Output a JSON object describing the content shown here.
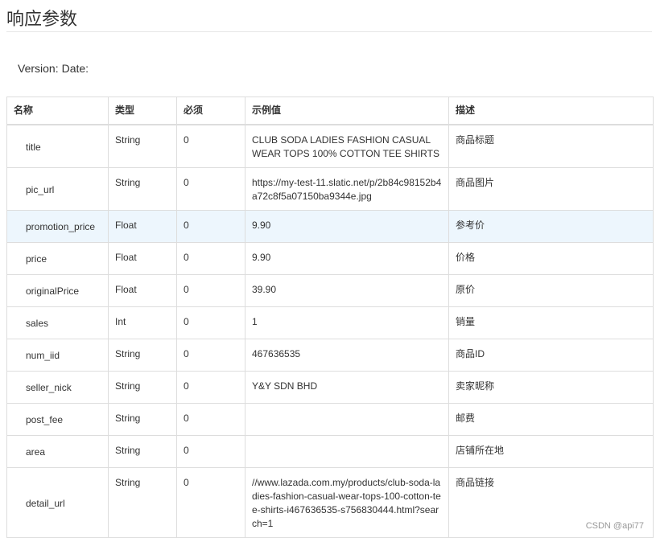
{
  "page_title": "响应参数",
  "meta": {
    "version_label": "Version:",
    "date_label": "Date:"
  },
  "table": {
    "headers": [
      "名称",
      "类型",
      "必须",
      "示例值",
      "描述"
    ],
    "rows": [
      {
        "name": "title",
        "type": "String",
        "required": "0",
        "example": "CLUB SODA LADIES FASHION CASUAL WEAR TOPS 100% COTTON TEE SHIRTS",
        "desc": "商品标题"
      },
      {
        "name": "pic_url",
        "type": "String",
        "required": "0",
        "example": "https://my-test-11.slatic.net/p/2b84c98152b4a72c8f5a07150ba9344e.jpg",
        "desc": "商品图片"
      },
      {
        "name": "promotion_price",
        "type": "Float",
        "required": "0",
        "example": "9.90",
        "desc": "参考价"
      },
      {
        "name": "price",
        "type": "Float",
        "required": "0",
        "example": "9.90",
        "desc": "价格"
      },
      {
        "name": "originalPrice",
        "type": "Float",
        "required": "0",
        "example": "39.90",
        "desc": "原价"
      },
      {
        "name": "sales",
        "type": "Int",
        "required": "0",
        "example": "1",
        "desc": "销量"
      },
      {
        "name": "num_iid",
        "type": "String",
        "required": "0",
        "example": "467636535",
        "desc": "商品ID"
      },
      {
        "name": "seller_nick",
        "type": "String",
        "required": "0",
        "example": "Y&Y SDN BHD",
        "desc": "卖家昵称"
      },
      {
        "name": "post_fee",
        "type": "String",
        "required": "0",
        "example": "",
        "desc": "邮费"
      },
      {
        "name": "area",
        "type": "String",
        "required": "0",
        "example": "",
        "desc": "店铺所在地"
      },
      {
        "name": "detail_url",
        "type": "String",
        "required": "0",
        "example": "//www.lazada.com.my/products/club-soda-ladies-fashion-casual-wear-tops-100-cotton-tee-shirts-i467636535-s756830444.html?search=1",
        "desc": "商品链接"
      }
    ],
    "highlighted_row": "promotion_price"
  },
  "watermark": "CSDN @api77",
  "colors": {
    "border": "#dddddd",
    "highlight_row": "#edf6fd",
    "text": "#333333"
  }
}
